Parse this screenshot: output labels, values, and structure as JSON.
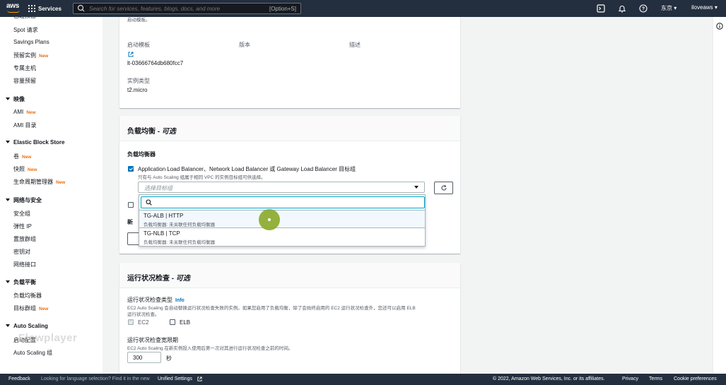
{
  "topnav": {
    "logo_text": "aws",
    "services_label": "Services",
    "search_placeholder": "Search for services, features, blogs, docs, and more",
    "search_shortcut": "[Option+S]",
    "region": "东京 ▾",
    "user": "iloveaws ▾"
  },
  "sidebar": {
    "items": [
      {
        "label": "Spot 请求"
      },
      {
        "label": "Savings Plans"
      },
      {
        "label": "预留实例",
        "badge": "New"
      },
      {
        "label": "专属主机"
      },
      {
        "label": "容量预留"
      }
    ],
    "sections": [
      {
        "title": "映像",
        "items": [
          {
            "label": "AMI",
            "badge": "New"
          },
          {
            "label": "AMI 目录"
          }
        ]
      },
      {
        "title": "Elastic Block Store",
        "items": [
          {
            "label": "卷",
            "badge": "New"
          },
          {
            "label": "快照",
            "badge": "New"
          },
          {
            "label": "生命周期管理器",
            "badge": "New"
          }
        ]
      },
      {
        "title": "网络与安全",
        "items": [
          {
            "label": "安全组"
          },
          {
            "label": "弹性 IP"
          },
          {
            "label": "置放群组"
          },
          {
            "label": "密钥对"
          },
          {
            "label": "网络接口"
          }
        ]
      },
      {
        "title": "负载平衡",
        "items": [
          {
            "label": "负载均衡器"
          },
          {
            "label": "目标群组",
            "badge": "New"
          }
        ]
      },
      {
        "title": "Auto Scaling",
        "items": [
          {
            "label": "启动配置"
          },
          {
            "label": "Auto Scaling 组"
          }
        ]
      }
    ]
  },
  "launch_template": {
    "top_text": "启动模板。",
    "col_template": "启动模板",
    "col_version": "版本",
    "col_description": "描述",
    "template_id": "lt-03666764db680fcc7",
    "instance_type_label": "实例类型",
    "instance_type": "t2.micro"
  },
  "load_balancing": {
    "title": "负载均衡 - ",
    "title_optional": "可选",
    "subtitle": "负载均衡器",
    "checkbox_label": "Application Load Balancer、Network Load Balancer 或 Gateway Load Balancer 目标组",
    "checkbox_hint": "只有与 Auto Scaling 组属于相同 VPC 的实例目标组可供选择。",
    "select_placeholder": "选择目标组",
    "new_partial": "新 ",
    "options": [
      {
        "title": "TG-ALB | HTTP",
        "subtitle": "负载均衡器: 未关联任何负载均衡器"
      },
      {
        "title": "TG-NLB | TCP",
        "subtitle": "负载均衡器: 未关联任何负载均衡器"
      }
    ]
  },
  "health_check": {
    "title": "运行状况检查 - ",
    "title_optional": "可选",
    "type_label": "运行状况检查类型",
    "info": "Info",
    "type_desc_1": "EC2 Auto Scaling 会自动替换运行状况检查失败的实例。如果您启用了负载均衡，除了会始终启用的 EC2 运行状况检查外，您还可以启用 ELB",
    "type_desc_2": "运行状况检查。",
    "ec2_label": "EC2",
    "elb_label": "ELB",
    "grace_label": "运行状况检查宽限期",
    "grace_desc": "EC2 Auto Scaling 在新实例投入使用后第一次对其进行运行状况检查之前的时间。",
    "grace_value": "300",
    "grace_unit": "秒"
  },
  "watermark": "Flowplayer",
  "footer": {
    "feedback": "Feedback",
    "language_text": "Looking for language selection? Find it in the new",
    "unified_settings": "Unified Settings",
    "copyright": "© 2022, Amazon Web Services, Inc. or its affiliates.",
    "privacy": "Privacy",
    "terms": "Terms",
    "cookie": "Cookie preferences"
  },
  "colors": {
    "nav_bg": "#232f3e",
    "accent_orange": "#ec7211",
    "link_blue": "#0073bb",
    "focus_blue": "#00a1c9"
  }
}
